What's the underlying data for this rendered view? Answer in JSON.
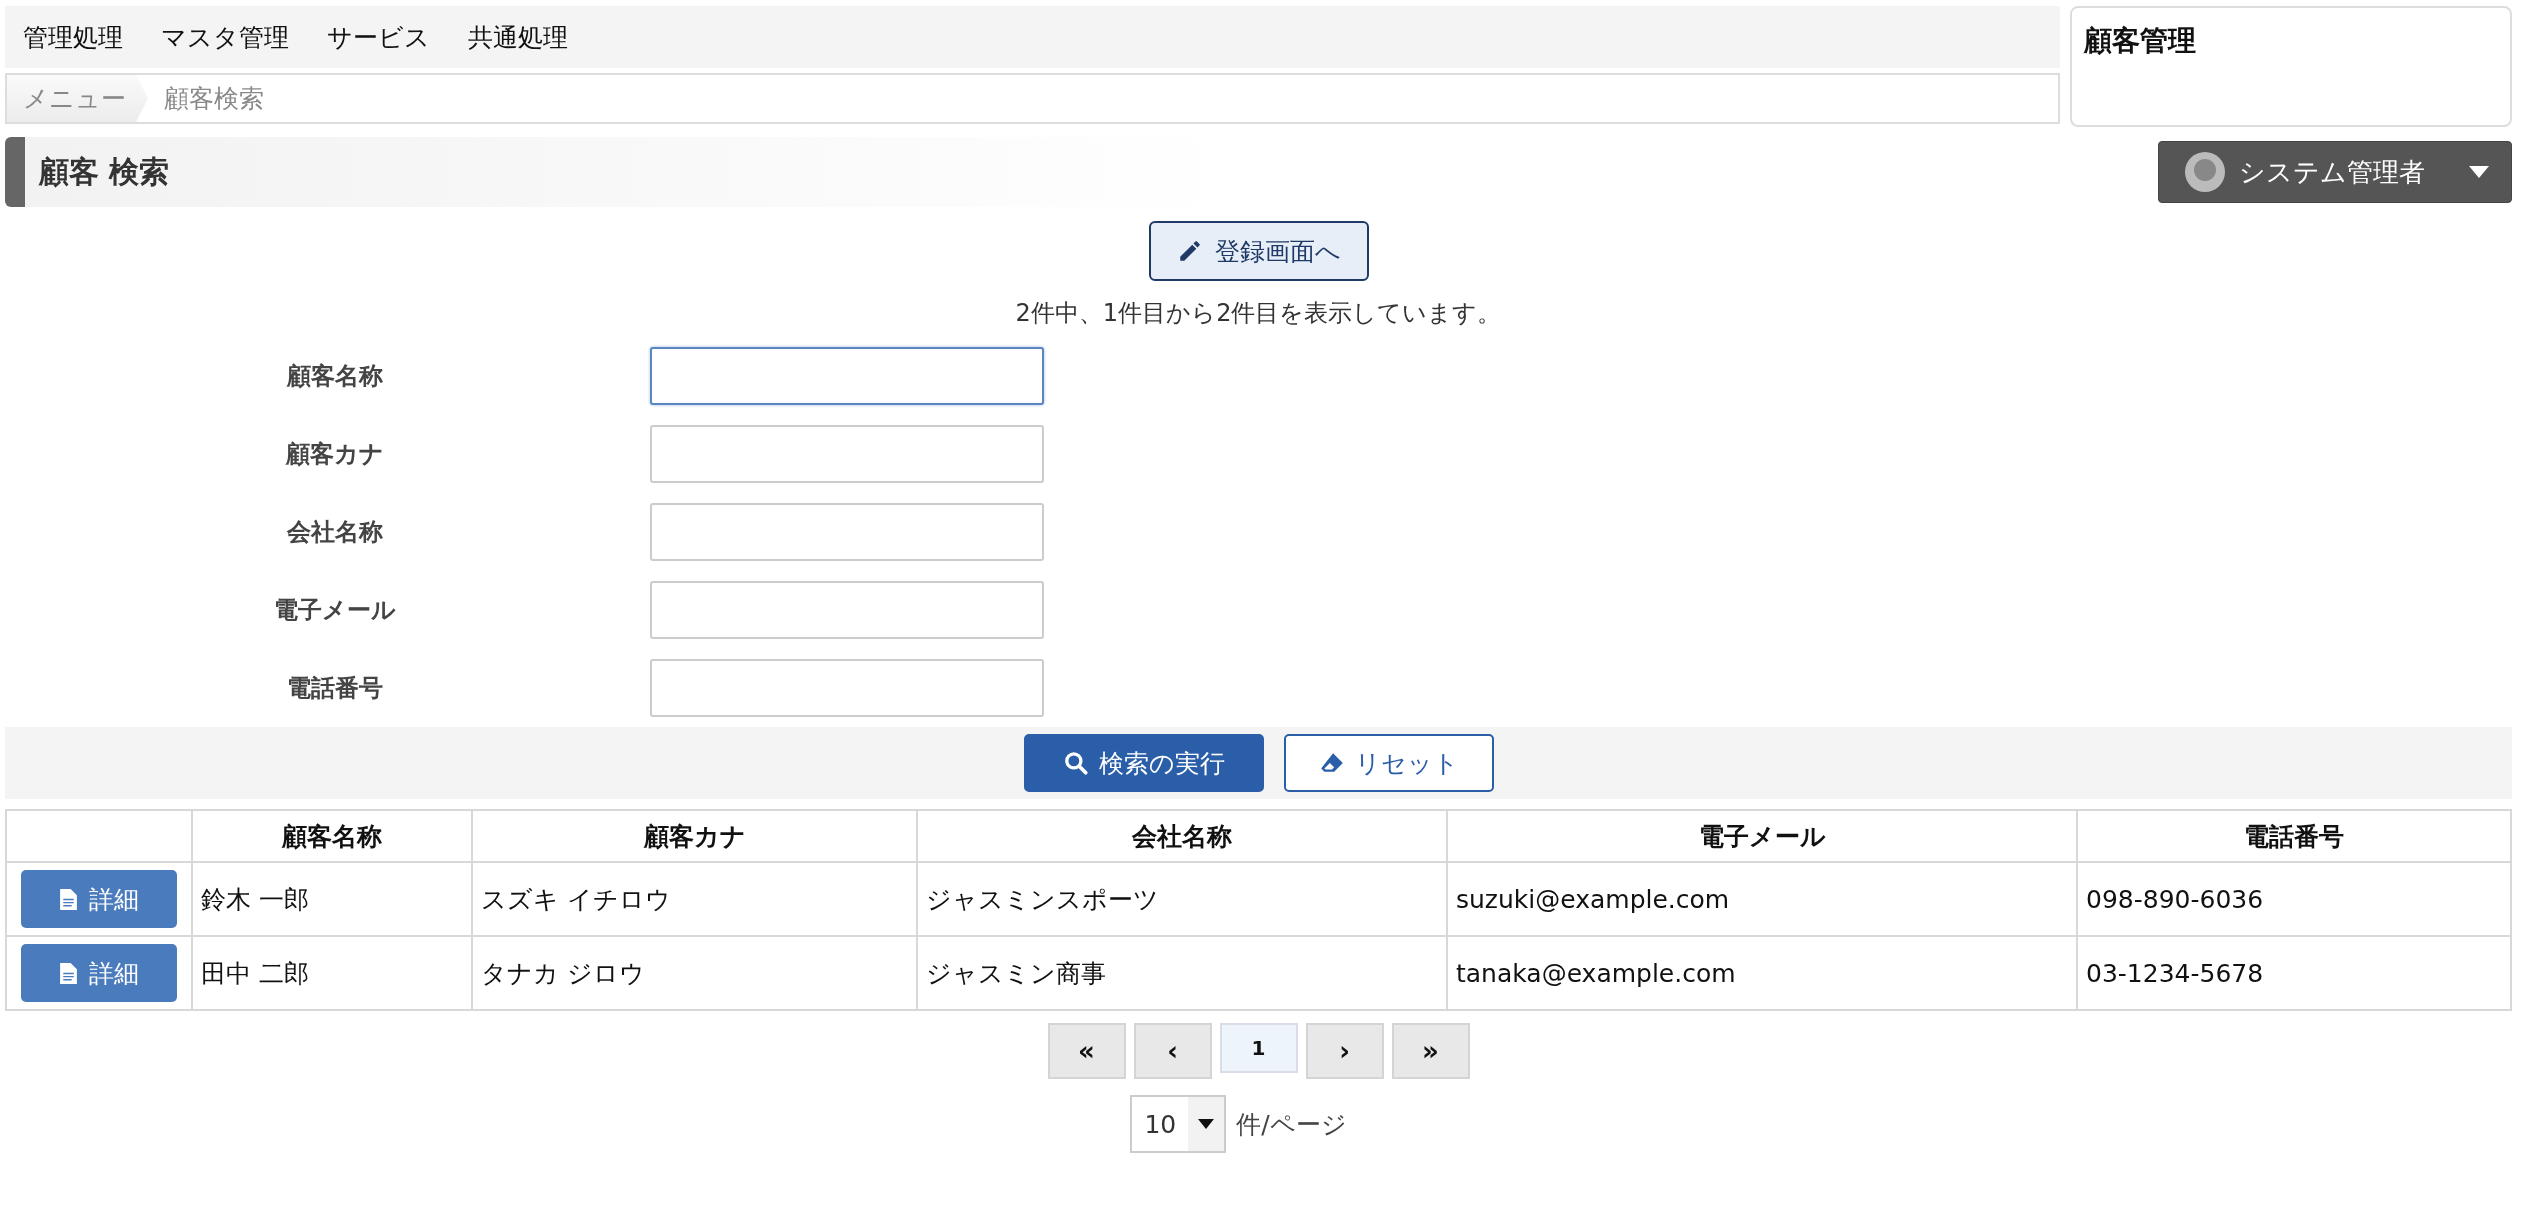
{
  "menu": {
    "items": [
      {
        "label": "管理処理"
      },
      {
        "label": "マスタ管理"
      },
      {
        "label": "サービス"
      },
      {
        "label": "共通処理"
      }
    ]
  },
  "breadcrumb": [
    {
      "label": "メニュー",
      "kind": "link"
    },
    {
      "label": "顧客検索",
      "kind": "current"
    }
  ],
  "app_panel": {
    "title": "顧客管理"
  },
  "page_title": "顧客 検索",
  "user_menu": {
    "label": "システム管理者"
  },
  "register_button": {
    "label": "登録画面へ"
  },
  "result_summary": "2件中、1件目から2件目を表示しています。",
  "form": {
    "fields": [
      {
        "label": "顧客名称",
        "focused": true
      },
      {
        "label": "顧客カナ",
        "focused": false
      },
      {
        "label": "会社名称",
        "focused": false
      },
      {
        "label": "電子メール",
        "focused": false
      },
      {
        "label": "電話番号",
        "focused": false
      }
    ]
  },
  "actions": [
    {
      "label": "検索の実行",
      "kind": "primary"
    },
    {
      "label": "リセット",
      "kind": "secondary"
    }
  ],
  "table": {
    "columns": [
      "顧客名称",
      "顧客カナ",
      "会社名称",
      "電子メール",
      "電話番号"
    ],
    "rows": [
      {
        "detail_button": "詳細",
        "cells": [
          "鈴木 一郎",
          "スズキ イチロウ",
          "ジャスミンスポーツ",
          "suzuki@example.com",
          "098-890-6036"
        ]
      },
      {
        "detail_button": "詳細",
        "cells": [
          "田中 二郎",
          "タナカ ジロウ",
          "ジャスミン商事",
          "tanaka@example.com",
          "03-1234-5678"
        ]
      }
    ]
  },
  "pagination": [
    {
      "label": "«",
      "selected": false
    },
    {
      "label": "‹",
      "selected": false
    },
    {
      "label": "1",
      "selected": true
    },
    {
      "label": "›",
      "selected": false
    },
    {
      "label": "»",
      "selected": false
    }
  ],
  "page_size": {
    "value": "10",
    "unit": "件/ページ"
  }
}
